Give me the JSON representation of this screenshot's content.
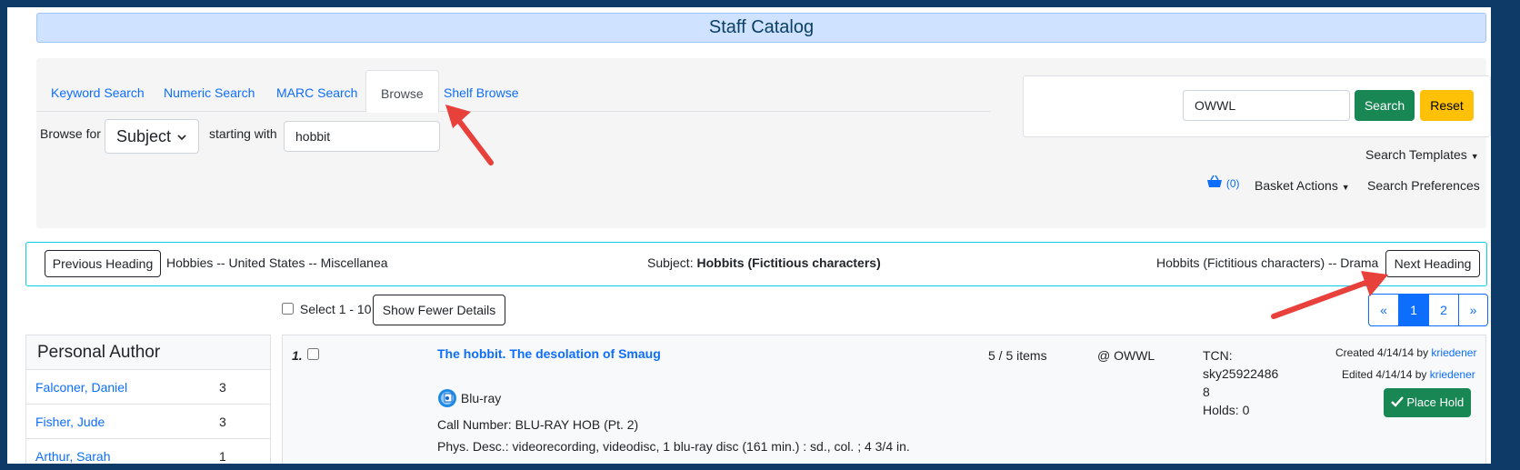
{
  "header": {
    "title": "Staff Catalog"
  },
  "tabs": [
    {
      "label": "Keyword Search",
      "active": false
    },
    {
      "label": "Numeric Search",
      "active": false
    },
    {
      "label": "MARC Search",
      "active": false
    },
    {
      "label": "Browse",
      "active": true
    },
    {
      "label": "Shelf Browse",
      "active": false
    }
  ],
  "browse": {
    "browse_for_label": "Browse for",
    "browse_for_value": "Subject",
    "starting_with_label": "starting with",
    "starting_with_value": "hobbit"
  },
  "search_box": {
    "org_value": "OWWL",
    "search_label": "Search",
    "reset_label": "Reset"
  },
  "menus": {
    "search_templates": "Search Templates",
    "basket_count": "(0)",
    "basket_actions": "Basket Actions",
    "search_preferences": "Search Preferences"
  },
  "heading_nav": {
    "previous_label": "Previous Heading",
    "previous_heading": "Hobbies -- United States -- Miscellanea",
    "subject_prefix": "Subject:",
    "subject_value": "Hobbits (Fictitious characters)",
    "next_heading": "Hobbits (Fictitious characters) -- Drama",
    "next_label": "Next Heading"
  },
  "results_toolbar": {
    "select_label": "Select 1 - 10",
    "details_label": "Show Fewer Details"
  },
  "pagination": [
    "«",
    "1",
    "2",
    "»"
  ],
  "facet": {
    "title": "Personal Author",
    "items": [
      {
        "name": "Falconer, Daniel",
        "count": "3"
      },
      {
        "name": "Fisher, Jude",
        "count": "3"
      },
      {
        "name": "Arthur, Sarah",
        "count": "1"
      }
    ]
  },
  "result": {
    "number": "1.",
    "title": "The hobbit. The desolation of Smaug",
    "format": "Blu-ray",
    "call_number": "Call Number: BLU-RAY HOB (Pt. 2)",
    "phys_desc": "Phys. Desc.: videorecording, videodisc, 1 blu-ray disc (161 min.) : sd., col. ; 4 3/4 in.",
    "items": "5 / 5 items",
    "location": "@ OWWL",
    "tcn_label": "TCN:",
    "tcn_value_1": "sky25922486",
    "tcn_value_2": "8",
    "holds": "Holds: 0",
    "created": "Created 4/14/14 by",
    "edited": "Edited 4/14/14 by",
    "user": "kriedener",
    "place_hold": "Place Hold"
  },
  "colors": {
    "annotation_arrow": "#e8413c",
    "primary": "#0d6efd",
    "success": "#198754",
    "warning": "#ffc107",
    "border": "#0d3a66"
  }
}
